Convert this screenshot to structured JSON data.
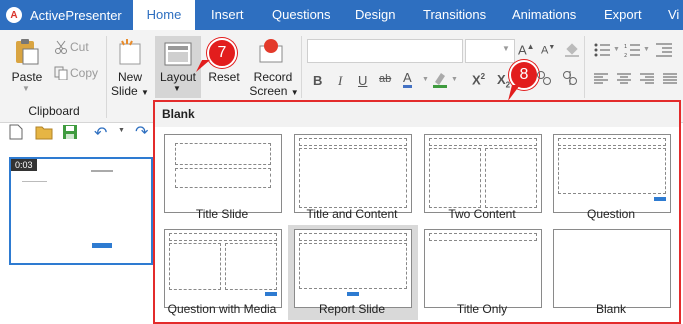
{
  "app": {
    "logo": "A",
    "name": "ActivePresenter"
  },
  "tabs": [
    "Home",
    "Insert",
    "Questions",
    "Design",
    "Transitions",
    "Animations",
    "Export",
    "Vi"
  ],
  "ribbon": {
    "cut": "Cut",
    "copy": "Copy",
    "paste": "Paste",
    "clipboard_group": "Clipboard",
    "new_slide": [
      "New",
      "Slide"
    ],
    "layout": "Layout",
    "reset": "Reset",
    "record_screen": [
      "Record",
      "Screen"
    ]
  },
  "callouts": [
    "7",
    "8"
  ],
  "slide_thumb": {
    "time": "0:03"
  },
  "layout_menu": {
    "header": "Blank",
    "items": [
      "Title Slide",
      "Title and Content",
      "Two Content",
      "Question",
      "Question with Media",
      "Report Slide",
      "Title Only",
      "Blank"
    ],
    "selected": "Report Slide"
  },
  "colors": {
    "accent": "#2e6fc0",
    "callout": "#e21d1d"
  }
}
